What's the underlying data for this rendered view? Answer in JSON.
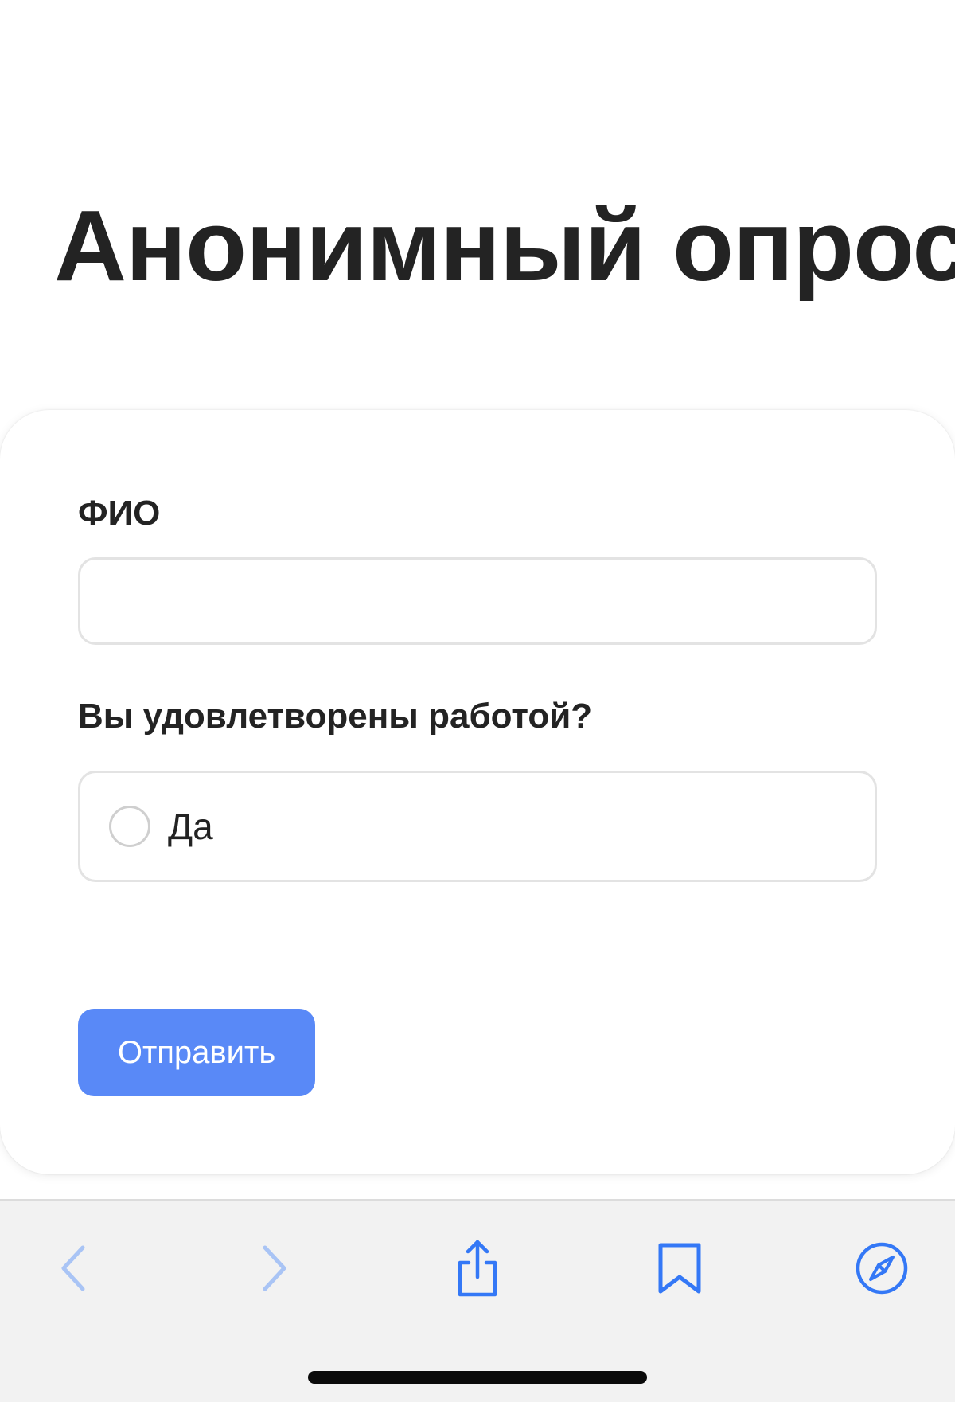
{
  "page": {
    "title": "Анонимный опрос"
  },
  "form": {
    "fio_label": "ФИО",
    "fio_value": "",
    "question_label": "Вы удовлетворены работой?",
    "options": [
      {
        "label": "Да",
        "selected": false
      }
    ],
    "submit_label": "Отправить"
  },
  "toolbar": {
    "icons": [
      "back-chevron-icon",
      "forward-chevron-icon",
      "share-icon",
      "bookmarks-icon",
      "safari-compass-icon"
    ],
    "accent_color": "#3478f6",
    "disabled_color": "#a9c4f5"
  },
  "colors": {
    "submit_button": "#5989f7",
    "title_text": "#232323"
  }
}
